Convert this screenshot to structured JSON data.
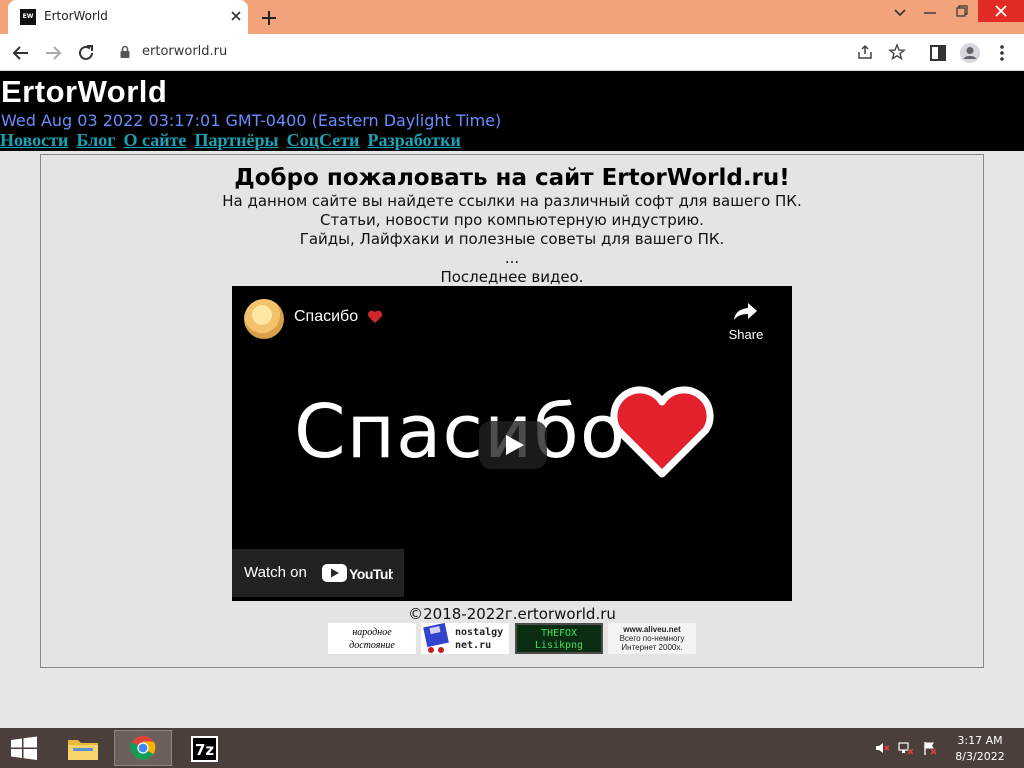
{
  "browser": {
    "tab": {
      "favicon_text": "EW",
      "title": "ErtorWorld"
    },
    "url": "ertorworld.ru"
  },
  "site": {
    "title": "ErtorWorld",
    "datetime": "Wed Aug 03 2022 03:17:01 GMT-0400 (Eastern Daylight Time)",
    "nav": [
      "Новости",
      "Блог",
      "О сайте",
      "Партнёры",
      "СоцСети",
      "Разработки"
    ]
  },
  "main": {
    "heading": "Добро пожаловать на сайт ErtorWorld.ru!",
    "lines": [
      "На данном сайте вы найдете ссылки на различный софт для вашего ПК.",
      "Статьи, новости про компьютерную индустрию.",
      "Гайды, Лайфхаки и полезные советы для вашего ПК.",
      "...",
      "Последнее видео."
    ],
    "video": {
      "title": "Спасибо",
      "share_label": "Share",
      "big_text": "Спасибо",
      "watch_on_label": "Watch on",
      "youtube_label": "YouTube"
    },
    "copyright": "©2018-2022г.ertorworld.ru",
    "badges": [
      {
        "text": [
          "народное",
          "достояние"
        ]
      },
      {
        "text": [
          "nostalgy",
          "net.ru"
        ]
      },
      {
        "text": [
          "THEFOX",
          "Lisikpng"
        ]
      },
      {
        "text": [
          "www.aliveu.net",
          "Всего по-немногу",
          "Интернет 2000х."
        ]
      }
    ]
  },
  "taskbar": {
    "apps": [
      "File Explorer",
      "Google Chrome",
      "7-Zip"
    ],
    "time": "3:17 AM",
    "date": "8/3/2022"
  },
  "colors": {
    "titlebar": "#f2a37b",
    "header_bg": "#000000",
    "date_text": "#6b8cff",
    "nav_link": "#1aa3b5",
    "taskbar": "#4a3f3a",
    "heart": "#e3212d"
  }
}
